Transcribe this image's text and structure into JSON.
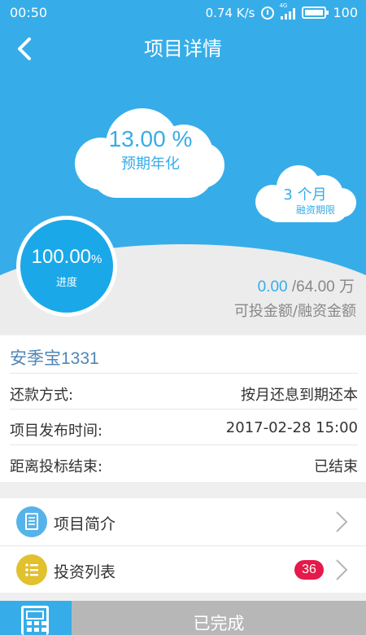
{
  "status_bar": {
    "time": "00:50",
    "net_speed": "0.74 K/s",
    "network_label": "4G",
    "battery": "100"
  },
  "header": {
    "title": "项目详情"
  },
  "summary": {
    "rate_value": "13.00",
    "rate_unit": "%",
    "rate_label": "预期年化",
    "term_value": "3 个月",
    "term_label": "融资期限",
    "progress_value": "100.00",
    "progress_unit": "%",
    "progress_label": "进度",
    "available_amount": "0.00",
    "total_amount": "/64.00 万",
    "amount_caption": "可投金额/融资金额"
  },
  "project": {
    "name": "安季宝1331",
    "rows": [
      {
        "label": "还款方式:",
        "value": "按月还息到期还本"
      },
      {
        "label": "项目发布时间:",
        "value": "2017-02-28 15:00"
      },
      {
        "label": "距离投标结束:",
        "value": "已结束"
      }
    ]
  },
  "menu": {
    "intro_label": "项目简介",
    "invest_list_label": "投资列表",
    "invest_count": "36"
  },
  "bottom": {
    "status_label": "已完成"
  },
  "colors": {
    "sky": "#36ade9",
    "progress": "#1aa8e8",
    "badge": "#e5194a",
    "intro_icon": "#56b3ea",
    "list_icon": "#e1c12e"
  }
}
